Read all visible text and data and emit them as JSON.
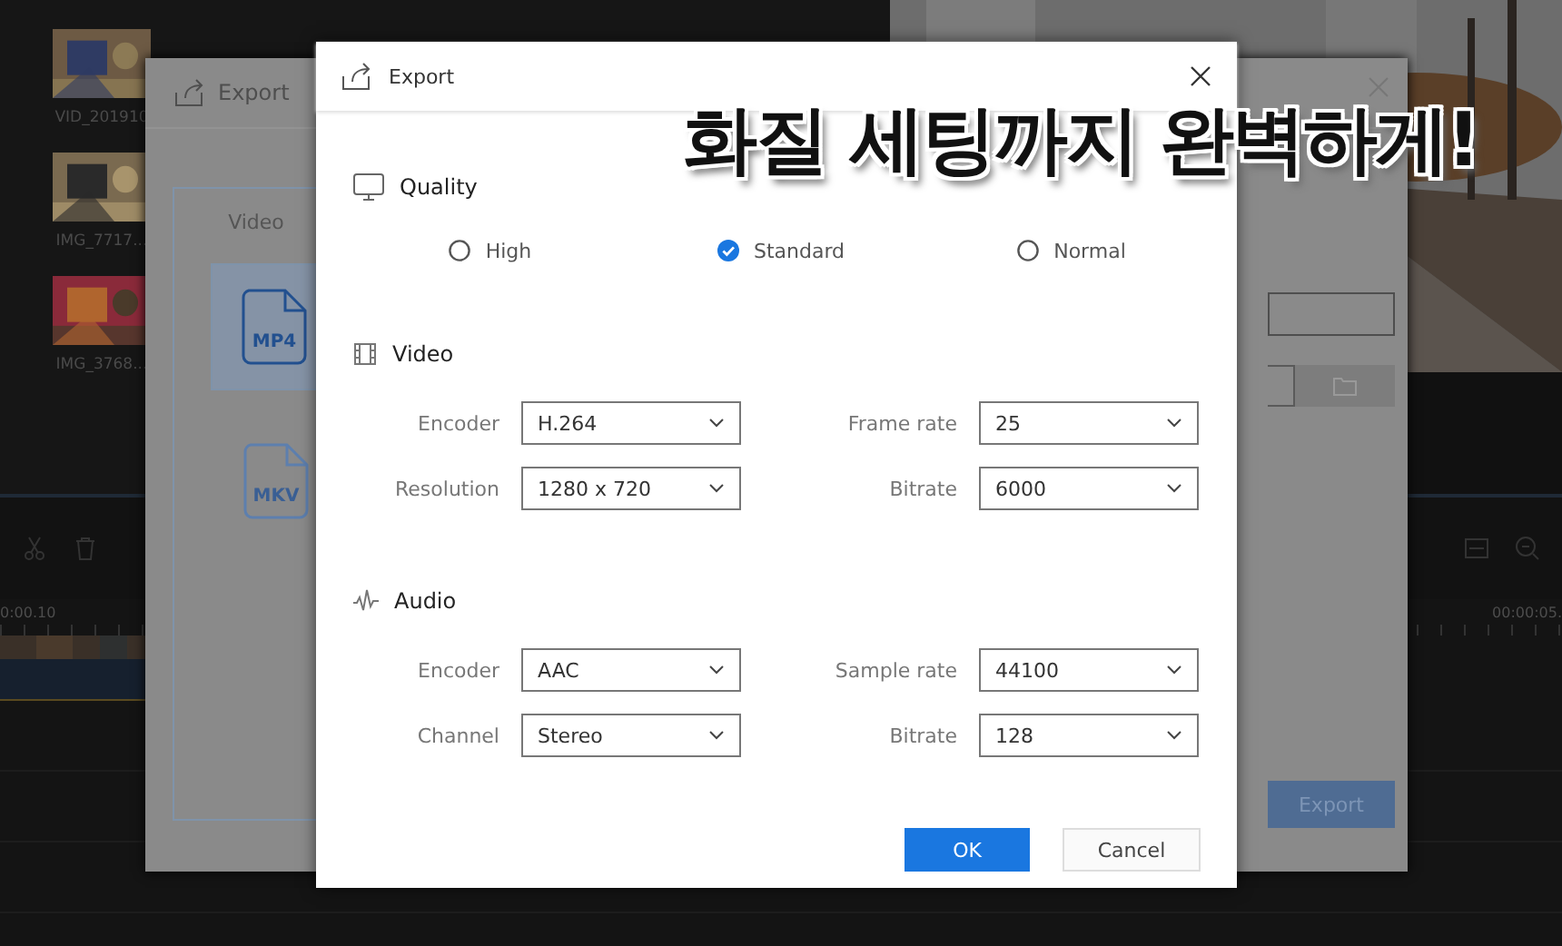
{
  "editor": {
    "media": [
      {
        "label": "VID_201910"
      },
      {
        "label": "IMG_7717..."
      },
      {
        "label": "IMG_3768..."
      }
    ],
    "timeline": {
      "start_time": "0:00.10",
      "end_time": "00:00:05."
    }
  },
  "background_dialog": {
    "title": "Export",
    "format_group": "Video",
    "formats": [
      {
        "label": "MP4",
        "selected": true
      },
      {
        "label": "MKV",
        "selected": false
      }
    ],
    "export_button": "Export"
  },
  "dialog": {
    "title": "Export",
    "sections": [
      {
        "kind": "quality",
        "title": "Quality",
        "options": [
          {
            "label": "High",
            "selected": false
          },
          {
            "label": "Standard",
            "selected": true
          },
          {
            "label": "Normal",
            "selected": false
          }
        ]
      },
      {
        "kind": "video",
        "title": "Video",
        "fields": [
          {
            "label": "Encoder",
            "value": "H.264"
          },
          {
            "label": "Frame rate",
            "value": "25"
          },
          {
            "label": "Resolution",
            "value": "1280 x 720"
          },
          {
            "label": "Bitrate",
            "value": "6000"
          }
        ]
      },
      {
        "kind": "audio",
        "title": "Audio",
        "fields": [
          {
            "label": "Encoder",
            "value": "AAC"
          },
          {
            "label": "Sample rate",
            "value": "44100"
          },
          {
            "label": "Channel",
            "value": "Stereo"
          },
          {
            "label": "Bitrate",
            "value": "128"
          }
        ]
      }
    ],
    "buttons": [
      {
        "label": "OK",
        "kind": "primary"
      },
      {
        "label": "Cancel",
        "kind": "secondary"
      }
    ]
  },
  "caption": "화질 세팅까지 완벽하게!"
}
